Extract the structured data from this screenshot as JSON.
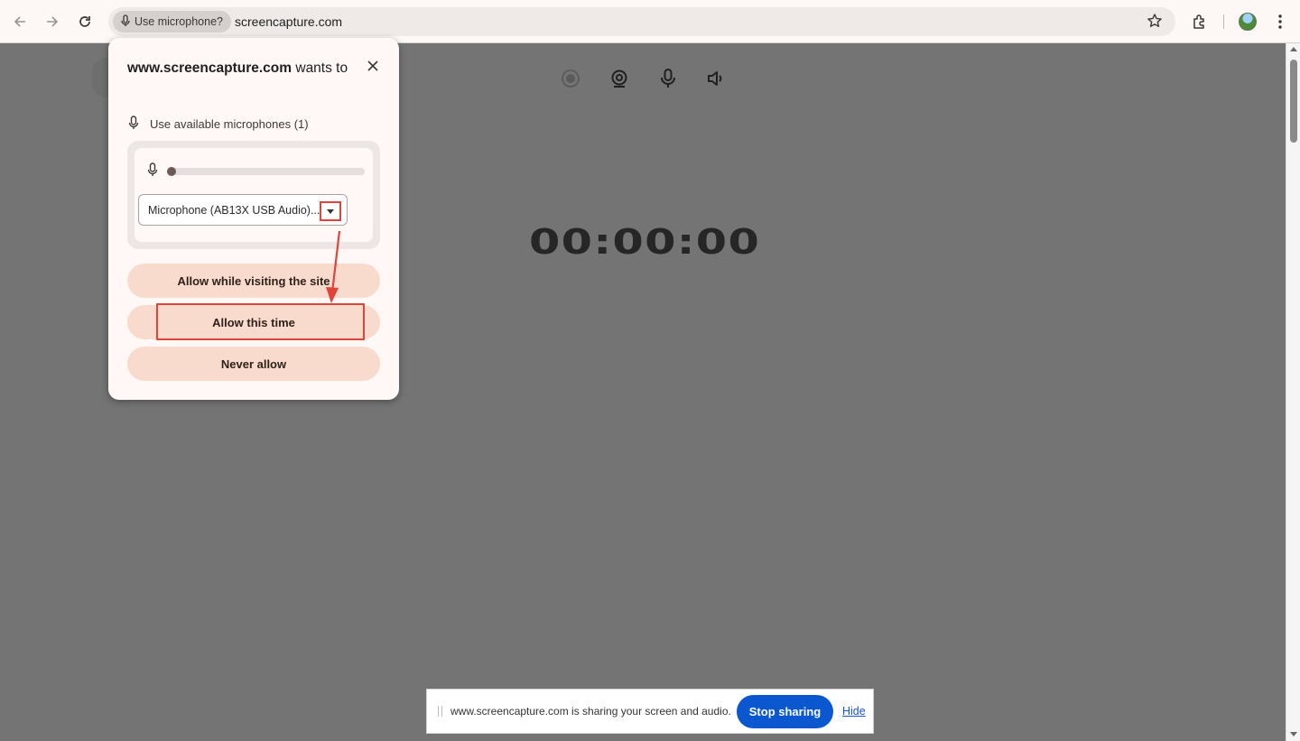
{
  "browser": {
    "permission_chip": "Use microphone?",
    "url": "screencapture.com",
    "icons": [
      "back-arrow-icon",
      "forward-arrow-icon",
      "reload-icon",
      "microphone-icon",
      "star-icon",
      "extensions-icon",
      "profile-avatar",
      "kebab-menu-icon"
    ]
  },
  "page": {
    "timer": "00:00:00",
    "controls": [
      "record-icon",
      "webcam-icon",
      "microphone-icon",
      "speaker-icon"
    ]
  },
  "popup": {
    "title_bold": "www.screencapture.com",
    "title_rest": " wants to",
    "permission_label": "Use available microphones (1)",
    "mic_level": 0.0,
    "selected_microphone": "Microphone (AB13X USB Audio)...",
    "buttons": {
      "allow_while_visiting": "Allow while visiting the site",
      "allow_this_time": "Allow this time",
      "never_allow": "Never allow"
    }
  },
  "share_bar": {
    "message": "www.screencapture.com is sharing your screen and audio.",
    "stop_label": "Stop sharing",
    "hide_label": "Hide"
  },
  "colors": {
    "accent_button": "#f8dbcc",
    "stop_button": "#0b57d0",
    "annotation": "#e0433a",
    "page_background": "#747474"
  }
}
